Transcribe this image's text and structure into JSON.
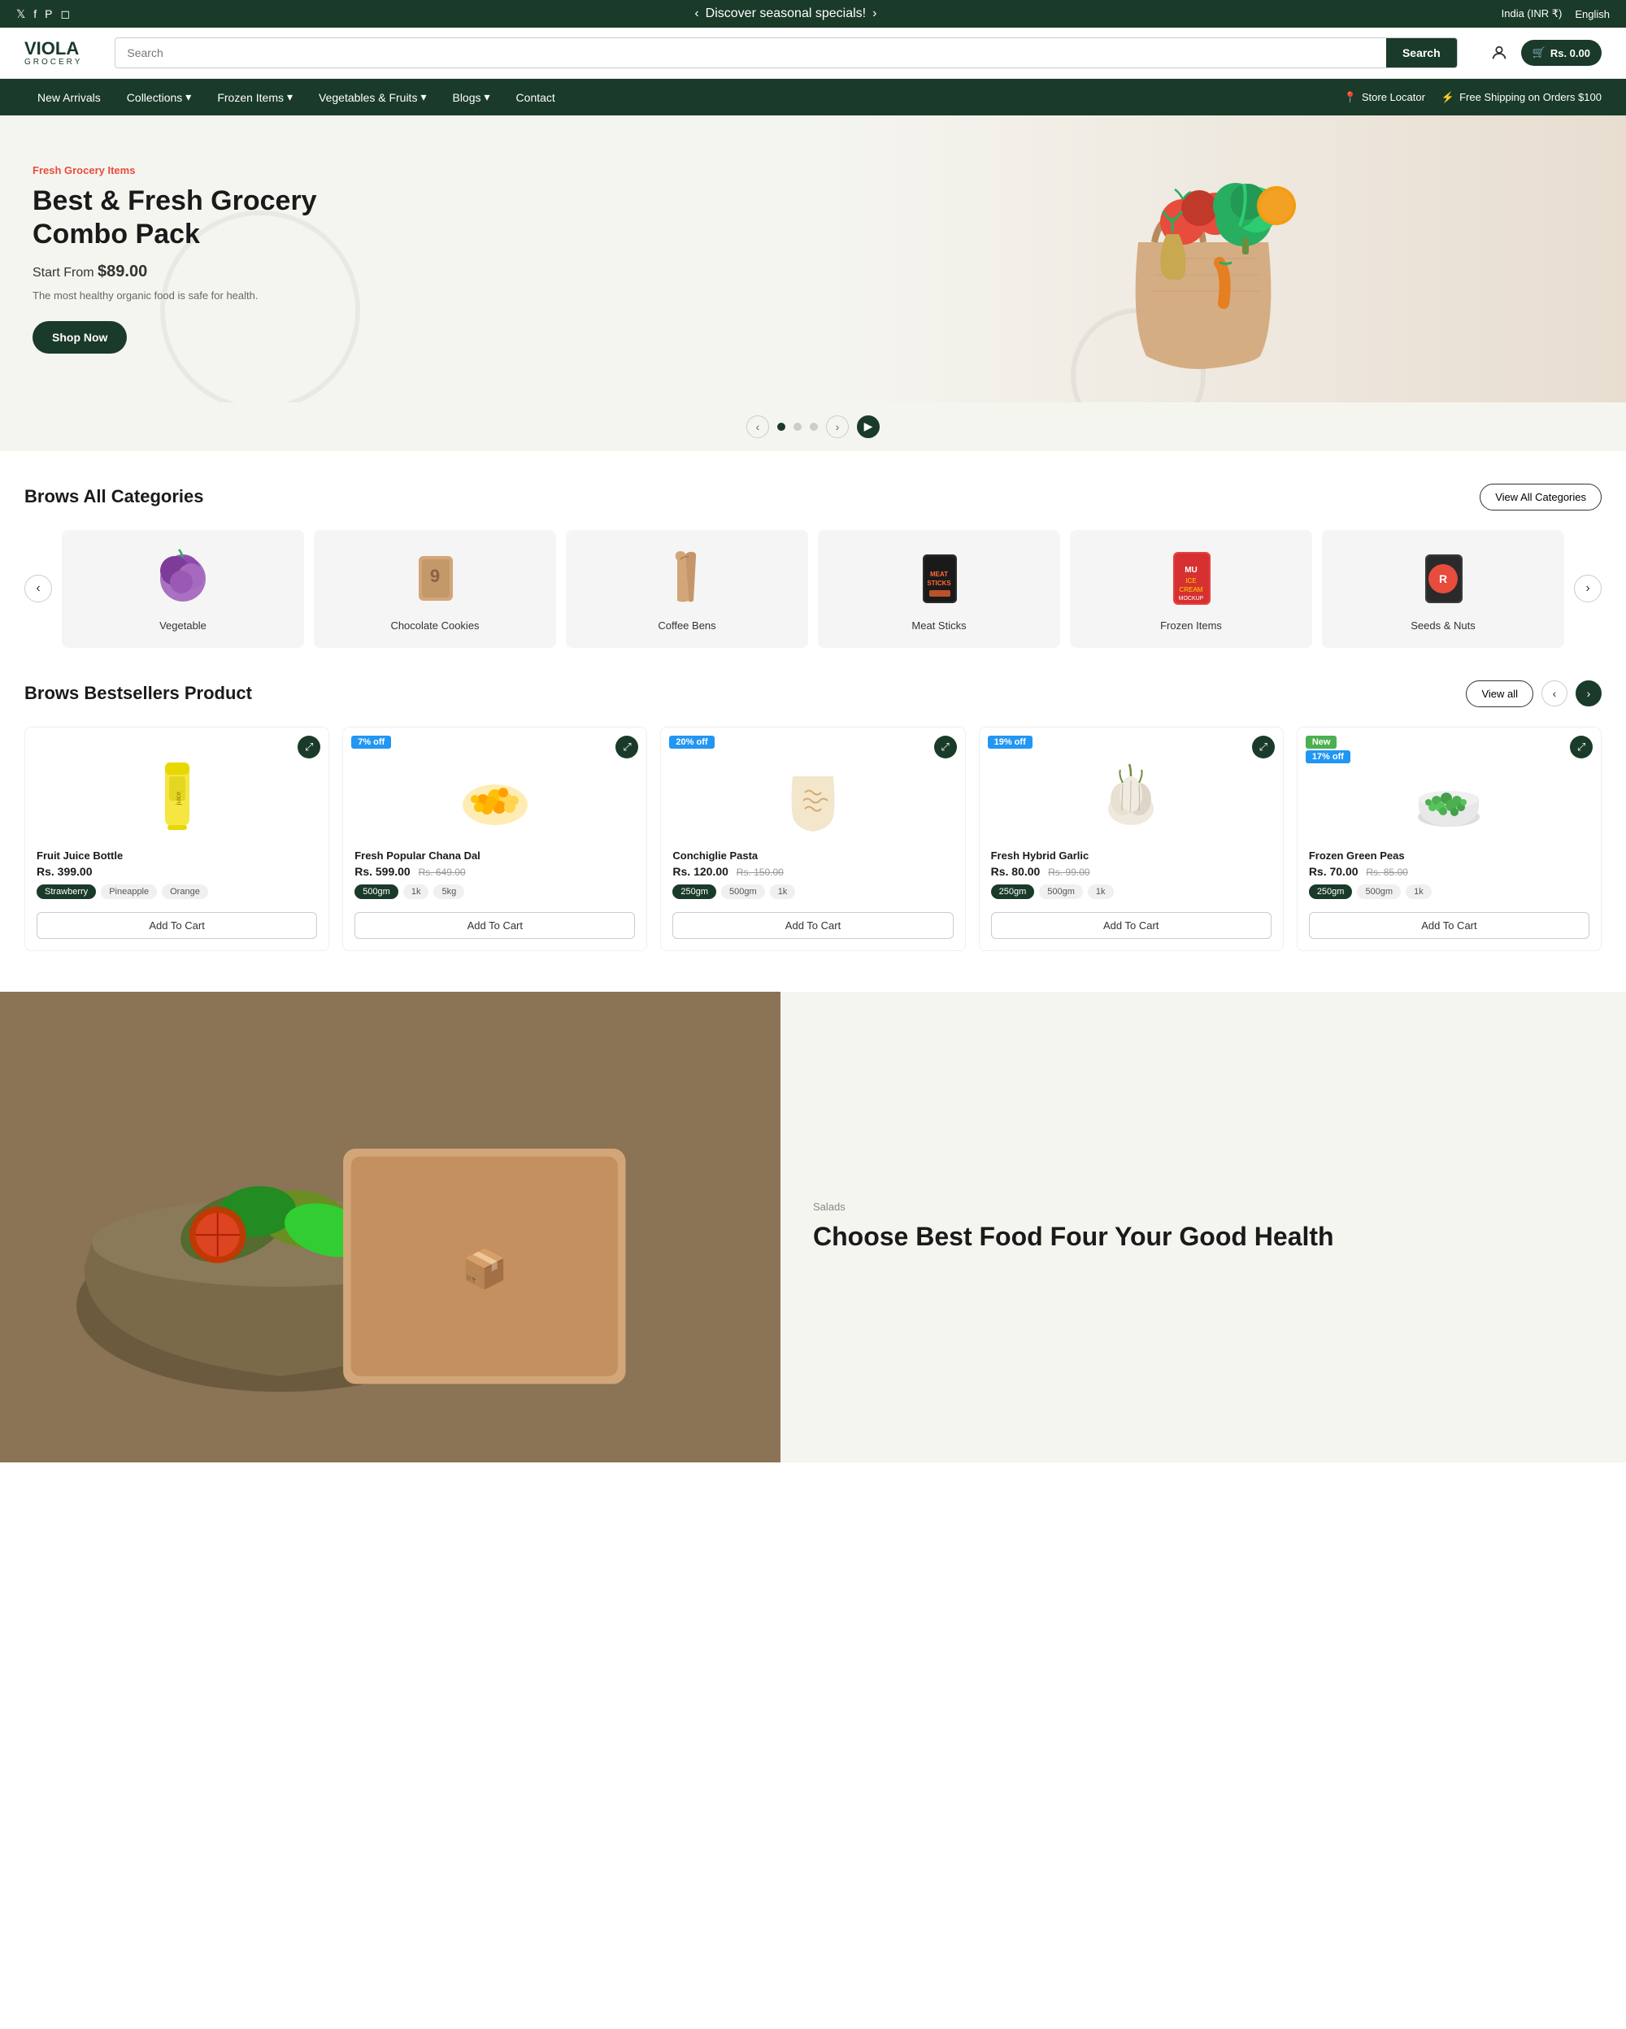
{
  "announcement": {
    "text": "Discover seasonal specials!",
    "left_arrow": "‹",
    "right_arrow": "›",
    "country": "India (INR ₹)",
    "language": "English"
  },
  "social": {
    "twitter": "𝕏",
    "facebook": "f",
    "pinterest": "P",
    "instagram": "◻"
  },
  "header": {
    "logo_main": "VIOLA",
    "logo_sub": "Grocery",
    "search_placeholder": "Search",
    "search_btn": "Search",
    "cart_label": "Rs. 0.00"
  },
  "nav": {
    "items": [
      {
        "label": "New Arrivals",
        "has_dropdown": false
      },
      {
        "label": "Collections",
        "has_dropdown": true
      },
      {
        "label": "Frozen Items",
        "has_dropdown": true
      },
      {
        "label": "Vegetables & Fruits",
        "has_dropdown": true
      },
      {
        "label": "Blogs",
        "has_dropdown": true
      },
      {
        "label": "Contact",
        "has_dropdown": false
      }
    ],
    "right_items": [
      {
        "label": "Store Locator",
        "icon": "📍"
      },
      {
        "label": "Free Shipping on Orders $100",
        "icon": "⚡"
      }
    ]
  },
  "hero": {
    "tag": "Fresh Grocery Items",
    "title": "Best & Fresh Grocery Combo Pack",
    "price_prefix": "Start From",
    "price": "$89.00",
    "description": "The most healthy organic food is safe for health.",
    "cta": "Shop Now"
  },
  "hero_dots": [
    {
      "active": true
    },
    {
      "active": false
    },
    {
      "active": false
    }
  ],
  "categories": {
    "title": "Brows All Categories",
    "view_all": "View All Categories",
    "items": [
      {
        "name": "Vegetable",
        "color": "#f0f0f0"
      },
      {
        "name": "Chocolate Cookies",
        "color": "#f0f0f0"
      },
      {
        "name": "Coffee Bens",
        "color": "#f0f0f0"
      },
      {
        "name": "Meat Sticks",
        "color": "#f0f0f0"
      },
      {
        "name": "Frozen Items",
        "color": "#f0f0f0"
      },
      {
        "name": "Seeds & Nuts",
        "color": "#f0f0f0"
      }
    ]
  },
  "bestsellers": {
    "title": "Brows Bestsellers Product",
    "view_all": "View all",
    "products": [
      {
        "name": "Fruit Juice Bottle",
        "price": "Rs. 399.00",
        "old_price": "",
        "badge": "",
        "badge_type": "",
        "sizes": [
          "Strawberry",
          "Pineapple",
          "Orange"
        ],
        "active_size": "Strawberry",
        "add_to_cart": "Add To Cart",
        "emoji": "🍾",
        "color": "#f5e642"
      },
      {
        "name": "Fresh Popular Chana Dal",
        "price": "Rs. 599.00",
        "old_price": "Rs. 649.00",
        "badge": "7% off",
        "badge_type": "off",
        "sizes": [
          "500gm",
          "1k",
          "5kg"
        ],
        "active_size": "500gm",
        "add_to_cart": "Add To Cart",
        "emoji": "🌽",
        "color": "#FFC107"
      },
      {
        "name": "Conchiglie Pasta",
        "price": "Rs. 120.00",
        "old_price": "Rs. 150.00",
        "badge": "20% off",
        "badge_type": "off",
        "sizes": [
          "250gm",
          "500gm",
          "1k"
        ],
        "active_size": "250gm",
        "add_to_cart": "Add To Cart",
        "emoji": "🍝",
        "color": "#F5DEB3"
      },
      {
        "name": "Fresh Hybrid Garlic",
        "price": "Rs. 80.00",
        "old_price": "Rs. 99.00",
        "badge": "19% off",
        "badge_type": "off",
        "sizes": [
          "250gm",
          "500gm",
          "1k"
        ],
        "active_size": "250gm",
        "add_to_cart": "Add To Cart",
        "emoji": "🧄",
        "color": "#D4C5B5"
      },
      {
        "name": "Frozen Green Peas",
        "price": "Rs. 70.00",
        "old_price": "Rs. 85.00",
        "badge_new": "New",
        "badge": "17% off",
        "badge_type": "new-off",
        "sizes": [
          "250gm",
          "500gm",
          "1k"
        ],
        "active_size": "250gm",
        "add_to_cart": "Add To Cart",
        "emoji": "🫛",
        "color": "#90EE90"
      }
    ]
  },
  "bottom_banner": {
    "tag": "Salads",
    "title": "Choose Best Food Four Your Good Health"
  }
}
